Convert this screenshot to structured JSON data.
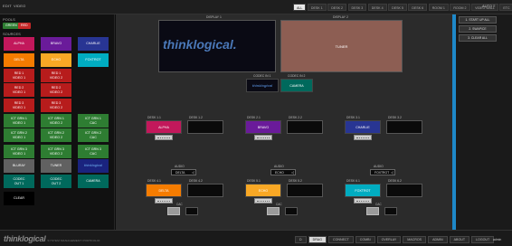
{
  "topbar": {
    "links": [
      "EDIT",
      "VIDEO"
    ],
    "tabs": [
      "ALL",
      "DESK 1",
      "DESK 2",
      "DESK 3",
      "DESK 4",
      "DESK 5",
      "DESK 6",
      "ROOM 1",
      "ROOM 2",
      "VIDEO WALL",
      "ETC"
    ],
    "active_tab": "ALL",
    "auto_label": "AUTO",
    "auto_menu": "≡"
  },
  "sidebar": {
    "pools_title": "POOLS",
    "pool_green": "GREEN",
    "pool_red": "RED",
    "sources_title": "SOURCES",
    "tiles": [
      {
        "label": "ALPHA",
        "color": "#c2185b"
      },
      {
        "label": "BRAVO",
        "color": "#6a1b9a"
      },
      {
        "label": "CHARLIE",
        "color": "#283593"
      },
      {
        "label": "DELTA",
        "color": "#f57c00"
      },
      {
        "label": "ECHO",
        "color": "#f9a825"
      },
      {
        "label": "FOXTROT",
        "color": "#00acc1"
      },
      {
        "label": "RED 1\nVIDEO 1",
        "color": "#b71c1c"
      },
      {
        "label": "RED 1\nVIDEO 2",
        "color": "#b71c1c"
      },
      {
        "label": "RED 2\nVIDEO 1",
        "color": "#b71c1c"
      },
      {
        "label": "RED 2\nVIDEO 2",
        "color": "#b71c1c"
      },
      {
        "label": "RED 3\nVIDEO 1",
        "color": "#b71c1c"
      },
      {
        "label": "RED 3\nVIDEO 2",
        "color": "#b71c1c"
      },
      {
        "label": "ICT GRN 1\nVIDEO 1",
        "color": "#2e7d32"
      },
      {
        "label": "ICT GRN 1\nVIDEO 2",
        "color": "#2e7d32"
      },
      {
        "label": "ICT GRN 1\nCAC",
        "color": "#2e7d32"
      },
      {
        "label": "ICT GRN 2\nVIDEO 1",
        "color": "#2e7d32"
      },
      {
        "label": "ICT GRN 2\nVIDEO 2",
        "color": "#2e7d32"
      },
      {
        "label": "ICT GRN 2\nCAC",
        "color": "#2e7d32"
      },
      {
        "label": "ICT GRN 3\nVIDEO 1",
        "color": "#2e7d32"
      },
      {
        "label": "ICT GRN 3\nVIDEO 2",
        "color": "#2e7d32"
      },
      {
        "label": "ICT GRN 3\nCAC",
        "color": "#2e7d32"
      },
      {
        "label": "BLURAY",
        "color": "#616161"
      },
      {
        "label": "TUNER",
        "color": "#616161"
      },
      {
        "label": "thinklogical",
        "color": "#1a237e"
      },
      {
        "label": "CODEC\nOUT 1",
        "color": "#00695c"
      },
      {
        "label": "CODEC\nOUT 2",
        "color": "#00695c"
      },
      {
        "label": "CAMERA",
        "color": "#00695c"
      },
      {
        "label": "CLEAR",
        "color": "#000000"
      }
    ]
  },
  "workspace": {
    "display1_label": "DISPLAY 1",
    "display1_content": "thinklogical.",
    "display2_label": "DISPLAY 2",
    "display2_content": "TUNER",
    "codec_in1_label": "CODEC IN 1",
    "codec_in1_content": "thinklogical",
    "codec_in2_label": "CODEC IN 2",
    "codec_in2_content": "CAMERA",
    "desks_top": [
      {
        "l1": "DESK 1.1",
        "l2": "DESK 1.2",
        "source": "ALPHA",
        "color": "#c2185b"
      },
      {
        "l1": "DESK 2.1",
        "l2": "DESK 2.2",
        "source": "BRAVO",
        "color": "#6a1b9a"
      },
      {
        "l1": "DESK 3.1",
        "l2": "DESK 3.2",
        "source": "CHARLIE",
        "color": "#283593"
      }
    ],
    "desks_bottom": [
      {
        "audio": "AUDIO",
        "audio_val": "DELTA",
        "l1": "DESK 4.1",
        "l2": "DESK 4.2",
        "source": "DELTA",
        "color": "#f57c00",
        "cac": "CAC"
      },
      {
        "audio": "AUDIO",
        "audio_val": "ECHO",
        "l1": "DESK 5.1",
        "l2": "DESK 5.2",
        "source": "ECHO",
        "color": "#f9a825",
        "cac": "CAC"
      },
      {
        "audio": "AUDIO",
        "audio_val": "FOXTROT",
        "l1": "DESK 6.1",
        "l2": "DESK 6.2",
        "source": "FOXTROT",
        "color": "#00acc1",
        "cac": "CAC"
      }
    ],
    "speaker_icon": "◁"
  },
  "rightpanel": {
    "buttons": [
      "1. START UP ALL",
      "2. SWAP/CE",
      "3. CLEAR ALL"
    ]
  },
  "bottombar": {
    "logo": "thinklogical",
    "logo_sub": "SYSTEM MANAGEMENT PORTFOLIO",
    "tabs": [
      "D",
      "DRAG",
      "CONNECT",
      "COMBI",
      "OVERLAY",
      "MACROS",
      "ADMIN",
      "ABOUT",
      "LOGOUT"
    ],
    "active_tab": "DRAG",
    "user": "admin"
  }
}
